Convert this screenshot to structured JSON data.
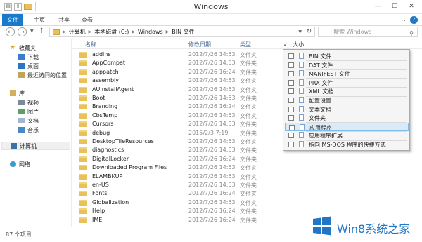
{
  "window": {
    "title": "Windows",
    "controls": {
      "minimize": "—",
      "maximize": "☐",
      "close": "✕"
    }
  },
  "ribbon": {
    "tabs": [
      "文件",
      "主页",
      "共享",
      "查看"
    ],
    "help": "?"
  },
  "address": {
    "crumbs": [
      "计算机",
      "本地磁盘 (C:)",
      "Windows",
      "BIN 文件"
    ],
    "search_placeholder": "搜索 Windows"
  },
  "nav": {
    "favorites": "收藏夹",
    "downloads": "下载",
    "desktop": "桌面",
    "recent": "最近访问的位置",
    "libraries": "库",
    "videos": "视频",
    "pictures": "图片",
    "documents": "文档",
    "music": "音乐",
    "computer": "计算机",
    "network": "网络"
  },
  "columns": {
    "name": "名称",
    "date": "修改日期",
    "type": "类型",
    "size": "大小"
  },
  "files": [
    {
      "name": "addins",
      "date": "2012/7/26 14:53",
      "type": "文件夹"
    },
    {
      "name": "AppCompat",
      "date": "2012/7/26 14:53",
      "type": "文件夹"
    },
    {
      "name": "apppatch",
      "date": "2012/7/26 16:24",
      "type": "文件夹"
    },
    {
      "name": "assembly",
      "date": "2012/7/26 14:53",
      "type": "文件夹"
    },
    {
      "name": "AUInstallAgent",
      "date": "2012/7/26 14:53",
      "type": "文件夹"
    },
    {
      "name": "Boot",
      "date": "2012/7/26 14:53",
      "type": "文件夹"
    },
    {
      "name": "Branding",
      "date": "2012/7/26 16:24",
      "type": "文件夹"
    },
    {
      "name": "CbsTemp",
      "date": "2012/7/26 14:53",
      "type": "文件夹"
    },
    {
      "name": "Cursors",
      "date": "2012/7/26 14:53",
      "type": "文件夹"
    },
    {
      "name": "debug",
      "date": "2015/2/3 7:19",
      "type": "文件夹"
    },
    {
      "name": "DesktopTileResources",
      "date": "2012/7/26 14:53",
      "type": "文件夹"
    },
    {
      "name": "diagnostics",
      "date": "2012/7/26 14:53",
      "type": "文件夹"
    },
    {
      "name": "DigitalLocker",
      "date": "2012/7/26 16:24",
      "type": "文件夹"
    },
    {
      "name": "Downloaded Program Files",
      "date": "2012/7/26 14:53",
      "type": "文件夹"
    },
    {
      "name": "ELAMBKUP",
      "date": "2012/7/26 14:53",
      "type": "文件夹"
    },
    {
      "name": "en-US",
      "date": "2012/7/26 14:53",
      "type": "文件夹"
    },
    {
      "name": "Fonts",
      "date": "2012/7/26 16:24",
      "type": "文件夹"
    },
    {
      "name": "Globalization",
      "date": "2012/7/26 14:53",
      "type": "文件夹"
    },
    {
      "name": "Help",
      "date": "2012/7/26 16:24",
      "type": "文件夹"
    },
    {
      "name": "IME",
      "date": "2012/7/26 16:24",
      "type": "文件夹"
    }
  ],
  "menu": {
    "items": [
      "BIN 文件",
      "DAT 文件",
      "MANIFEST 文件",
      "PRX 文件",
      "XML 文档",
      "配置设置",
      "文本文档",
      "文件夹",
      "应用程序",
      "应用程序扩展",
      "指向 MS-DOS 程序的快捷方式"
    ],
    "highlighted": "应用程序"
  },
  "status": {
    "count": "87 个项目"
  },
  "watermark": {
    "text": "Win8系统之家"
  },
  "colors": {
    "accent": "#1979ca",
    "folder": "#e8c15a",
    "highlight": "#d9ebf9"
  }
}
